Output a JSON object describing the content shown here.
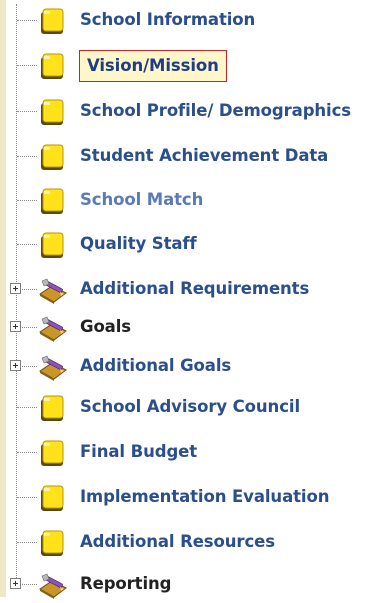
{
  "tree": {
    "items": [
      {
        "label": "School Information",
        "icon": "sticky-note-icon",
        "expandable": false
      },
      {
        "label": "Vision/Mission",
        "icon": "sticky-note-icon",
        "expandable": false,
        "selected": true
      },
      {
        "label": "School Profile/ Demographics",
        "icon": "sticky-note-icon",
        "expandable": false
      },
      {
        "label": "Student Achievement Data",
        "icon": "sticky-note-icon",
        "expandable": false
      },
      {
        "label": "School Match",
        "icon": "sticky-note-icon",
        "expandable": false
      },
      {
        "label": "Quality Staff",
        "icon": "sticky-note-icon",
        "expandable": false
      },
      {
        "label": "Additional Requirements",
        "icon": "pencil-book-icon",
        "expandable": true
      },
      {
        "label": "Goals",
        "icon": "pencil-book-icon",
        "expandable": true
      },
      {
        "label": "Additional Goals",
        "icon": "pencil-book-icon",
        "expandable": true
      },
      {
        "label": "School Advisory Council",
        "icon": "sticky-note-icon",
        "expandable": false
      },
      {
        "label": "Final Budget",
        "icon": "sticky-note-icon",
        "expandable": false
      },
      {
        "label": "Implementation Evaluation",
        "icon": "sticky-note-icon",
        "expandable": false
      },
      {
        "label": "Additional Resources",
        "icon": "sticky-note-icon",
        "expandable": false
      },
      {
        "label": "Reporting",
        "icon": "pencil-book-icon",
        "expandable": true
      }
    ]
  },
  "colors": {
    "link": "#2b4f8c",
    "visited_link": "#5b7ab8",
    "dark_text": "#222222",
    "selected_border": "#c8231f",
    "selected_background": "#fff7c9",
    "note_fill": "#ffe21a"
  }
}
